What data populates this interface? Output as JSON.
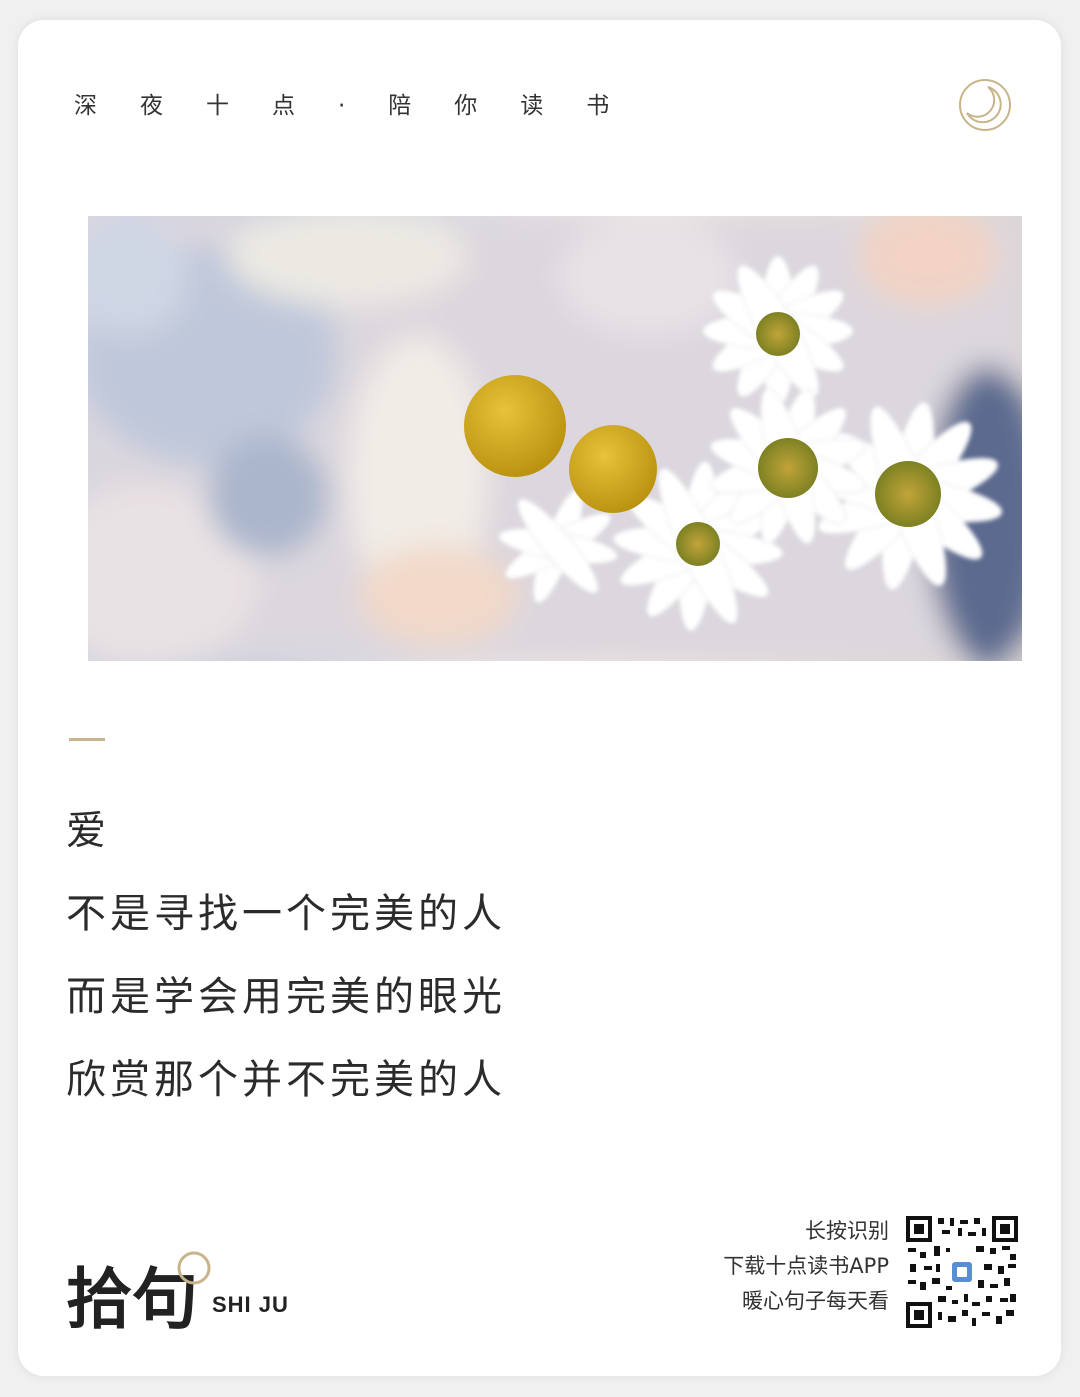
{
  "header": {
    "tagline": "深夜十点·陪你读书",
    "moon_icon": "moon-icon"
  },
  "photo": {
    "icon": "flower-photo"
  },
  "quote": {
    "lines": [
      "爱",
      "不是寻找一个完美的人",
      "而是学会用完美的眼光",
      "欣赏那个并不完美的人"
    ]
  },
  "brand": {
    "name_cn": "拾句",
    "name_en": "SHI JU"
  },
  "qr": {
    "line1": "长按识别",
    "line2": "下载十点读书APP",
    "line3": "暖心句子每天看",
    "icon": "qr-code-icon"
  },
  "colors": {
    "accent_gold": "#c8b48a",
    "text_dark": "#2b2b2b",
    "card_bg": "#ffffff"
  }
}
